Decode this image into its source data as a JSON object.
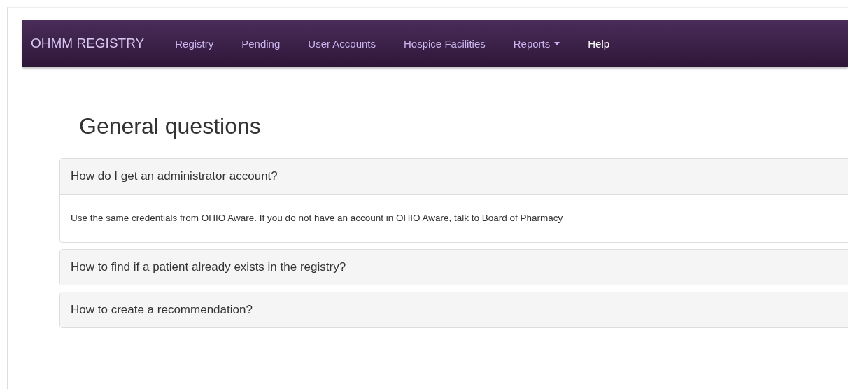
{
  "navbar": {
    "brand": "OHMM REGISTRY",
    "items": [
      {
        "label": "Registry",
        "kind": "link",
        "selected": false
      },
      {
        "label": "Pending",
        "kind": "link",
        "selected": false
      },
      {
        "label": "User Accounts",
        "kind": "link",
        "selected": false
      },
      {
        "label": "Hospice Facilities",
        "kind": "link",
        "selected": false
      },
      {
        "label": "Reports",
        "kind": "dropdown",
        "selected": false
      },
      {
        "label": "Help",
        "kind": "link",
        "selected": true
      }
    ]
  },
  "heading": "General questions",
  "faq": [
    {
      "question": "How do I get an administrator account?",
      "answer": "Use the same credentials from OHIO Aware. If you do not have an account in OHIO Aware, talk to Board of Pharmacy"
    },
    {
      "question": "How to find if a patient already exists in the registry?"
    },
    {
      "question": "How to create a recommendation?"
    }
  ]
}
